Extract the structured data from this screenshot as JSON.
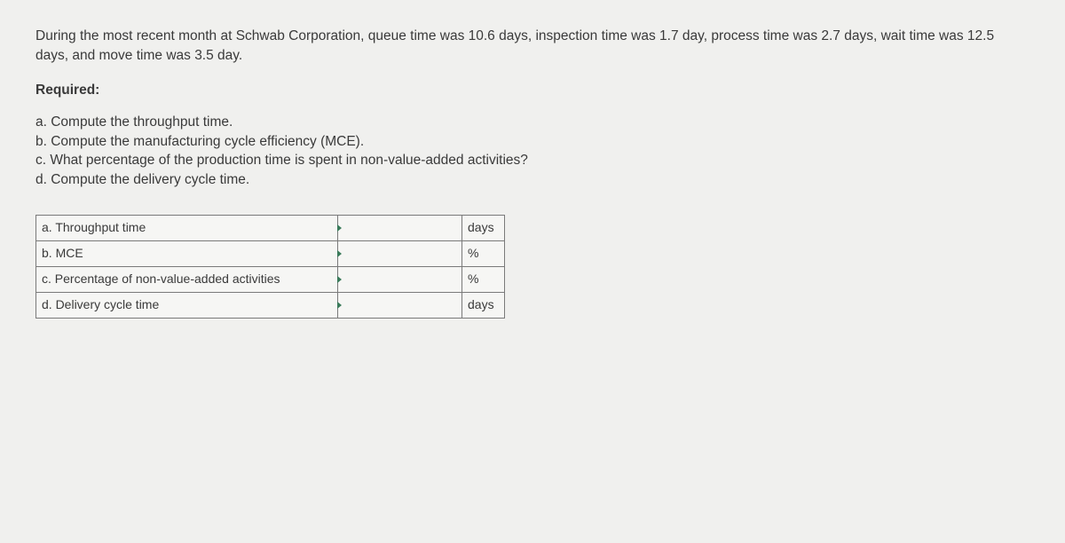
{
  "problem": {
    "statement": "During the most recent month at Schwab Corporation, queue time was 10.6 days, inspection time was 1.7 day, process time was 2.7 days, wait time was 12.5 days, and move time was 3.5 day.",
    "required_label": "Required:",
    "questions": {
      "a": "a. Compute the throughput time.",
      "b": "b. Compute the manufacturing cycle efficiency (MCE).",
      "c": "c. What percentage of the production time is spent in non-value-added activities?",
      "d": "d. Compute the delivery cycle time."
    }
  },
  "table": {
    "rows": [
      {
        "label": "a. Throughput time",
        "value": "",
        "unit": "days"
      },
      {
        "label": "b. MCE",
        "value": "",
        "unit": "%"
      },
      {
        "label": "c. Percentage of non-value-added activities",
        "value": "",
        "unit": "%"
      },
      {
        "label": "d. Delivery cycle time",
        "value": "",
        "unit": "days"
      }
    ]
  }
}
